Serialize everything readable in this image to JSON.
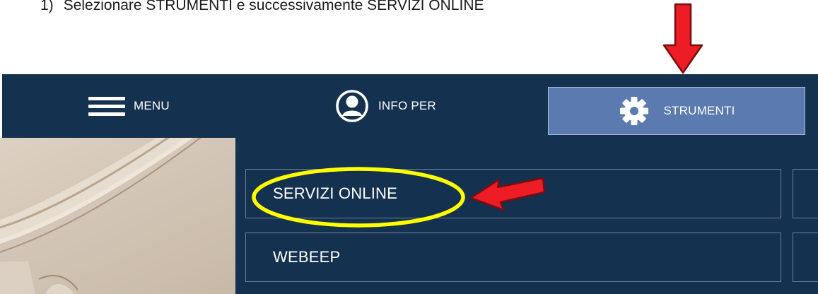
{
  "instruction": {
    "number": "1)",
    "text": "Selezionare STRUMENTI e successivamente SERVIZI ONLINE"
  },
  "navbar": {
    "menu_label": "MENU",
    "info_label": "INFO PER",
    "tools_label": "STRUMENTI"
  },
  "dropdown": {
    "items": [
      {
        "label": "SERVIZI ONLINE"
      },
      {
        "label": "WEBEEP"
      }
    ]
  },
  "annotations": {
    "arrow_color": "#ee1c24",
    "highlight_color": "#ffff00"
  },
  "colors": {
    "navbar_bg": "#143150",
    "active_tab_bg": "#5b7bb0"
  },
  "icons": {
    "menu": "hamburger-icon",
    "info": "user-circle-icon",
    "tools": "gear-icon"
  }
}
